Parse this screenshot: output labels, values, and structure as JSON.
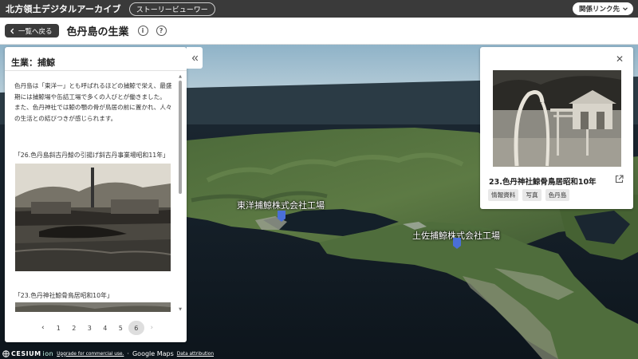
{
  "header": {
    "app_title": "北方領土デジタルアーカイブ",
    "story_view_label": "ストーリービューワー",
    "related_links_label": "関係リンク先"
  },
  "subheader": {
    "back_label": "一覧へ戻る",
    "page_title": "色丹島の生業"
  },
  "panel": {
    "heading": "生業：捕鯨",
    "description": "色丹島は「東洋一」とも呼ばれるほどの捕鯨で栄え、最盛期には捕鯨場や缶詰工場で多くの人びとが働きました。\nまた、色丹神社では鯨の顎の骨が鳥居の前に置かれ、人々の生活との結びつきが感じられます。",
    "items": [
      {
        "caption": "「26.色丹島斜古丹鯨の引揚げ斜古丹事業場昭和11年」"
      },
      {
        "caption": "「23.色丹神社鯨骨鳥居昭和10年」"
      }
    ],
    "pagination": {
      "pages": [
        "1",
        "2",
        "3",
        "4",
        "5",
        "6"
      ],
      "current": "6"
    }
  },
  "map": {
    "markers": [
      {
        "label": "東洋捕鯨株式会社工場"
      },
      {
        "label": "土佐捕鯨株式会社工場"
      }
    ],
    "marker_color": "#4a6fd8"
  },
  "detail": {
    "title": "23.色丹神社鯨骨鳥居昭和10年",
    "tags": [
      "情報資料",
      "写真",
      "色丹島"
    ]
  },
  "footer": {
    "cesium_label": "CESIUM",
    "ion_label": "ion",
    "upgrade_link": "Upgrade for commercial use.",
    "separator": "·",
    "google_maps": "Google Maps",
    "attribution_link": "Data attribution"
  }
}
